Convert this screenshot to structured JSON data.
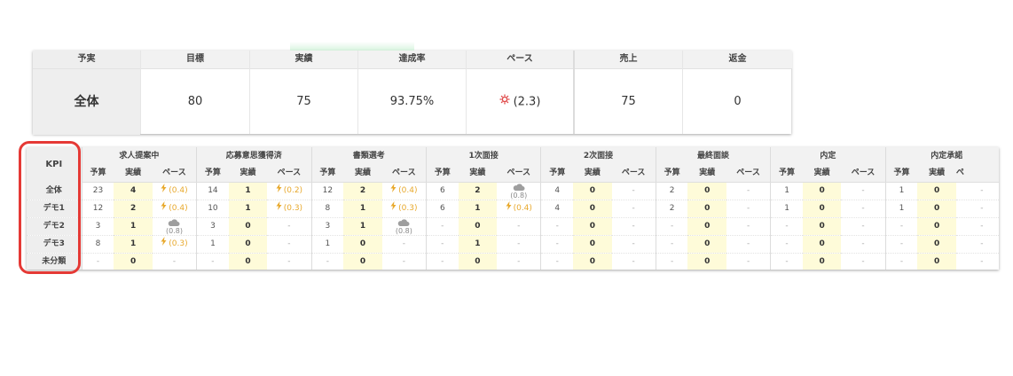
{
  "summary": {
    "headers": {
      "category": "予実",
      "target": "目標",
      "actual": "実績",
      "rate": "達成率",
      "pace": "ペース",
      "sales": "売上",
      "refund": "返金"
    },
    "row": {
      "category": "全体",
      "target": "80",
      "actual": "75",
      "rate": "93.75%",
      "pace": "(2.3)",
      "pace_icon": "sun-icon",
      "sales": "75",
      "refund": "0"
    },
    "pace_color": "#e04a4a"
  },
  "kpi": {
    "corner": "KPI",
    "subheaders": {
      "budget": "予算",
      "actual": "実績",
      "pace": "ペース"
    },
    "groups": [
      "求人提案中",
      "応募意思獲得済",
      "書類選考",
      "1次面接",
      "2次面接",
      "最終面談",
      "内定",
      "内定承諾"
    ],
    "last_pace_truncated": "ペ",
    "rows": [
      {
        "label": "全体",
        "cells": [
          [
            "23",
            "4",
            "(0.4)"
          ],
          [
            "14",
            "1",
            "(0.2)"
          ],
          [
            "12",
            "2",
            "(0.4)"
          ],
          [
            "6",
            "2",
            "(0.8)"
          ],
          [
            "4",
            "0",
            "-"
          ],
          [
            "2",
            "0",
            "-"
          ],
          [
            "1",
            "0",
            "-"
          ],
          [
            "1",
            "0",
            "-"
          ]
        ]
      },
      {
        "label": "デモ1",
        "cells": [
          [
            "12",
            "2",
            "(0.4)"
          ],
          [
            "10",
            "1",
            "(0.3)"
          ],
          [
            "8",
            "1",
            "(0.3)"
          ],
          [
            "6",
            "1",
            "(0.4)"
          ],
          [
            "4",
            "0",
            "-"
          ],
          [
            "2",
            "0",
            "-"
          ],
          [
            "1",
            "0",
            "-"
          ],
          [
            "1",
            "0",
            "-"
          ]
        ]
      },
      {
        "label": "デモ2",
        "cells": [
          [
            "3",
            "1",
            "(0.8)"
          ],
          [
            "3",
            "0",
            "-"
          ],
          [
            "3",
            "1",
            "(0.8)"
          ],
          [
            "-",
            "0",
            "-"
          ],
          [
            "-",
            "0",
            "-"
          ],
          [
            "-",
            "0",
            "-"
          ],
          [
            "-",
            "0",
            "-"
          ],
          [
            "-",
            "0",
            "-"
          ]
        ]
      },
      {
        "label": "デモ3",
        "cells": [
          [
            "8",
            "1",
            "(0.3)"
          ],
          [
            "1",
            "0",
            "-"
          ],
          [
            "1",
            "0",
            "-"
          ],
          [
            "-",
            "1",
            "-"
          ],
          [
            "-",
            "0",
            "-"
          ],
          [
            "-",
            "0",
            "-"
          ],
          [
            "-",
            "0",
            "-"
          ],
          [
            "-",
            "0",
            "-"
          ]
        ]
      },
      {
        "label": "未分類",
        "cells": [
          [
            "-",
            "0",
            "-"
          ],
          [
            "-",
            "0",
            "-"
          ],
          [
            "-",
            "0",
            "-"
          ],
          [
            "-",
            "0",
            "-"
          ],
          [
            "-",
            "0",
            "-"
          ],
          [
            "-",
            "0",
            "-"
          ],
          [
            "-",
            "0",
            "-"
          ],
          [
            "-",
            "0",
            "-"
          ]
        ]
      }
    ],
    "pace_icons": [
      [
        "bolt-icon",
        "bolt-icon",
        "bolt-icon",
        "cloud-icon",
        "",
        "",
        "",
        ""
      ],
      [
        "bolt-icon",
        "bolt-icon",
        "bolt-icon",
        "bolt-icon",
        "",
        "",
        "",
        ""
      ],
      [
        "cloud-icon",
        "",
        "cloud-icon",
        "",
        "",
        "",
        "",
        ""
      ],
      [
        "bolt-icon",
        "",
        "",
        "",
        "",
        "",
        "",
        ""
      ],
      [
        "",
        "",
        "",
        "",
        "",
        "",
        "",
        ""
      ]
    ],
    "colors": {
      "actual_bg": "#fefbd9",
      "bolt": "#e8a92d",
      "cloud": "#9e9e9e",
      "highlight": "#e53935"
    }
  }
}
